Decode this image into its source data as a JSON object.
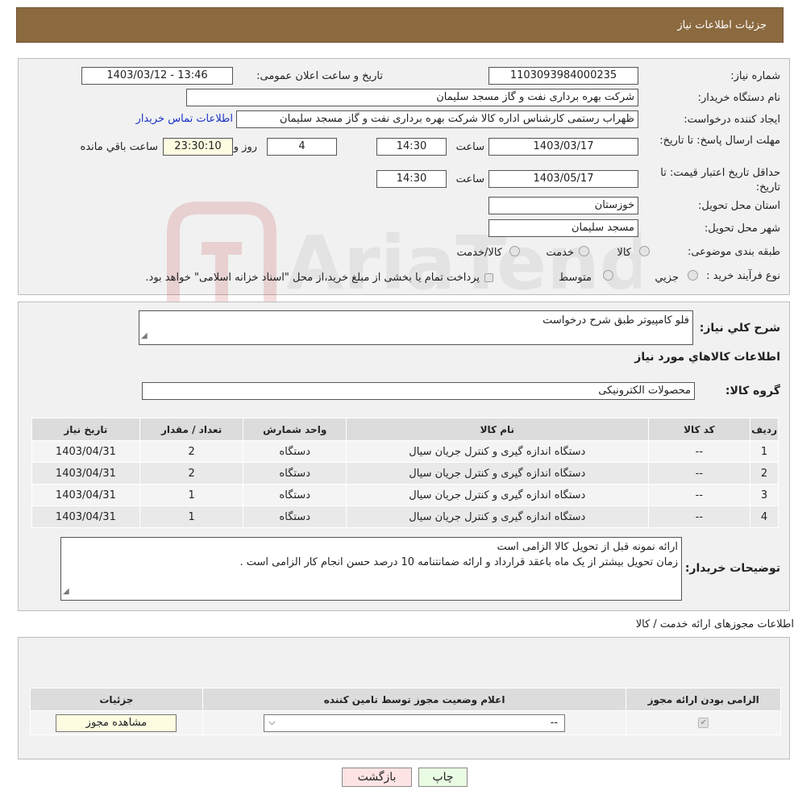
{
  "header": {
    "title": "جزئیات اطلاعات نیاز"
  },
  "form": {
    "need_number_label": "شماره نیاز:",
    "need_number": "1103093984000235",
    "announce_label": "تاریخ و ساعت اعلان عمومی:",
    "announce_value": "1403/03/12 - 13:46",
    "buyer_org_label": "نام دستگاه خریدار:",
    "buyer_org": "شرکت بهره برداری نفت و گاز مسجد سلیمان",
    "creator_label": "ایجاد کننده درخواست:",
    "creator": "ظهراب رستمی کارشناس اداره کالا  شرکت بهره برداری نفت و گاز مسجد سلیمان",
    "contact_link": "اطلاعات تماس خریدار",
    "deadline_label": "مهلت ارسال پاسخ: تا تاریخ:",
    "deadline_date": "1403/03/17",
    "time_label": "ساعت",
    "deadline_time": "14:30",
    "days_count": "4",
    "days_label": "روز و",
    "remaining_time": "23:30:10",
    "remaining_label": "ساعت باقي مانده",
    "validity_label": "حداقل تاریخ اعتبار قیمت: تا تاریخ:",
    "validity_date": "1403/05/17",
    "validity_time": "14:30",
    "province_label": "استان محل تحویل:",
    "province": "خوزستان",
    "city_label": "شهر محل تحویل:",
    "city": "مسجد سلیمان",
    "category_label": "طبقه بندی موضوعی:",
    "category_options": [
      "کالا",
      "خدمت",
      "کالا/خدمت"
    ],
    "process_label": "نوع فرآیند خرید :",
    "process_options": [
      "جزيي",
      "متوسط"
    ],
    "process_note": "پرداخت تمام یا بخشی از مبلغ خرید،از محل \"اسناد خزانه اسلامی\" خواهد بود."
  },
  "summary": {
    "desc_label": "شرح کلي نياز:",
    "desc_value": "فلو کامپیوتر طبق شرح درخواست",
    "goods_title": "اطلاعات کالاهاي مورد نياز",
    "group_label": "گروه کالا:",
    "group_value": "محصولات الکترونیکی"
  },
  "items_table": {
    "headers": [
      "رديف",
      "کد کالا",
      "نام کالا",
      "واحد شمارش",
      "تعداد / مقدار",
      "تاریخ نیاز"
    ],
    "rows": [
      [
        "1",
        "--",
        "دستگاه اندازه گیری و کنترل جریان سیال",
        "دستگاه",
        "2",
        "1403/04/31"
      ],
      [
        "2",
        "--",
        "دستگاه اندازه گیری و کنترل جریان سیال",
        "دستگاه",
        "2",
        "1403/04/31"
      ],
      [
        "3",
        "--",
        "دستگاه اندازه گیری و کنترل جریان سیال",
        "دستگاه",
        "1",
        "1403/04/31"
      ],
      [
        "4",
        "--",
        "دستگاه اندازه گیری و کنترل جریان سیال",
        "دستگاه",
        "1",
        "1403/04/31"
      ]
    ]
  },
  "buyer_notes": {
    "label": "توضیحات خریدار:",
    "line1": "ارائه نمونه قبل از تحویل کالا الزامی است",
    "line2": "زمان تحویل بیشتر از یک ماه باعقد قرارداد و ارائه ضمانتنامه 10 درصد حسن انجام کار الزامی است ."
  },
  "permits": {
    "title": "اطلاعات مجوزهای ارائه خدمت / کالا",
    "headers": [
      "الزامی بودن ارائه مجوز",
      "اعلام وضعیت مجوز توسط تامین کننده",
      "جزئیات"
    ],
    "select_value": "--",
    "view_button": "مشاهده مجوز"
  },
  "footer": {
    "print_button": "چاپ",
    "back_button": "بازگشت"
  },
  "watermark": {
    "text": "AriaTender.neT"
  }
}
